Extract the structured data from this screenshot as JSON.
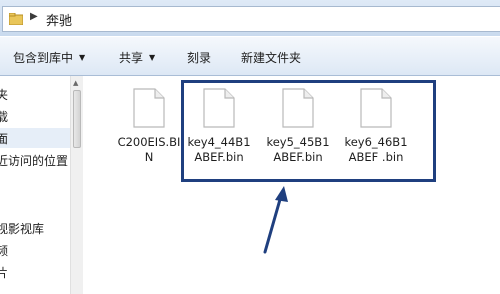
{
  "address_bar": {
    "path": "奔驰",
    "folder_icon": "folder-icon",
    "separator_icon": "chevron-right-icon"
  },
  "toolbar": {
    "items": [
      {
        "label": "包含到库中",
        "dropdown": true
      },
      {
        "label": "共享",
        "dropdown": true
      },
      {
        "label": "刻录",
        "dropdown": false
      },
      {
        "label": "新建文件夹",
        "dropdown": false
      }
    ]
  },
  "nav_pane": {
    "items": [
      "夹",
      "载",
      "面",
      "近访问的位置",
      "",
      "",
      "视影视库",
      "频",
      "片"
    ]
  },
  "files": [
    {
      "name": "C200EIS.BI\nN",
      "icon": "file-icon"
    },
    {
      "name": "key4_44B1\nABEF.bin",
      "icon": "file-icon"
    },
    {
      "name": "key5_45B1\nABEF.bin",
      "icon": "file-icon"
    },
    {
      "name": "key6_46B1\nABEF .bin",
      "icon": "file-icon"
    }
  ],
  "annotation": {
    "box_color": "#1f3f7f",
    "arrow_color": "#1f3f7f"
  }
}
